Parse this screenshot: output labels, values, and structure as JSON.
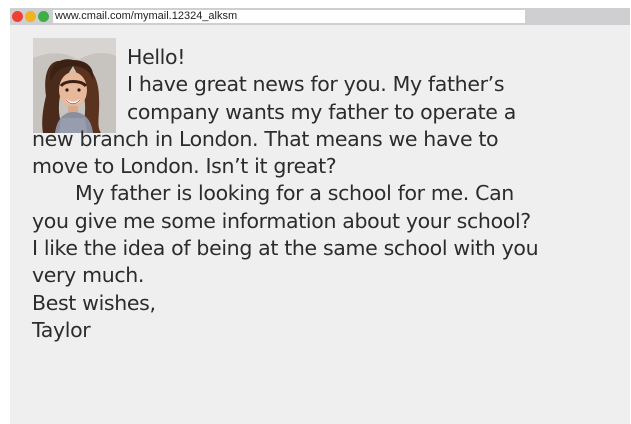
{
  "browser": {
    "url": "www.cmail.com/mymail.12324_alksm"
  },
  "icons": {
    "close": "red-dot-icon",
    "minimize": "yellow-dot-icon",
    "maximize": "green-dot-icon",
    "avatar": "avatar-photo"
  },
  "colors": {
    "red": "#ee4035",
    "yellow": "#f4b223",
    "green": "#3fae49",
    "background": "#efefef",
    "titlebar": "#cfcfd1"
  },
  "email": {
    "lines": [
      "Hello!",
      "I have great news for you. My father’s",
      "company wants my father to operate a",
      "new branch in London. That means we have to",
      "move to London. Isn’t it great?",
      "My father is looking for a school for me. Can",
      "you give me some information about your school?",
      "I like the idea of being at the same school with you",
      "very much.",
      "Best wishes,",
      "Taylor"
    ]
  }
}
